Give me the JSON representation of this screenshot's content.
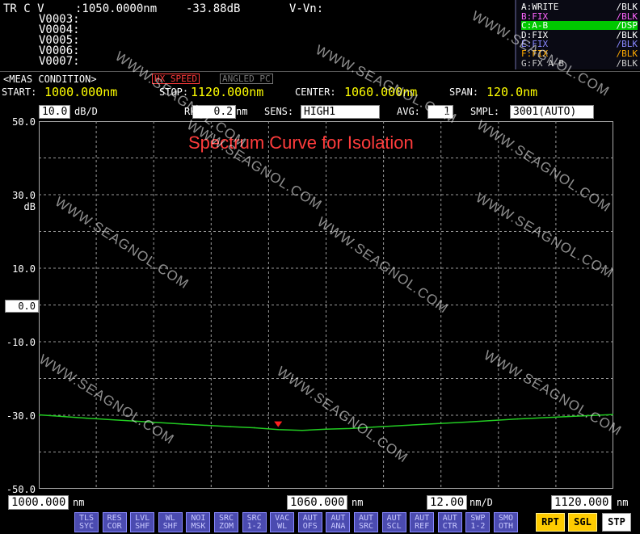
{
  "trace_info": {
    "header": "TR C V",
    "wavelength": ":1050.0000nm",
    "level": "-33.88dB",
    "delta": "V-Vn:",
    "rows": [
      "V0003:",
      "V0004:",
      "V0005:",
      "V0006:",
      "V0007:"
    ]
  },
  "trace_panel": [
    {
      "label": "A:WRITE",
      "mode": "/BLK",
      "color": "#ffffff"
    },
    {
      "label": "B:FIX",
      "mode": "/BLK",
      "color": "#ff66ff"
    },
    {
      "label": "C:A-B",
      "mode": "/DSP",
      "color": "#ffffff",
      "highlight": "#00c800"
    },
    {
      "label": "D:FIX",
      "mode": "/BLK",
      "color": "#ffffff"
    },
    {
      "label": "E:FIX",
      "mode": "/BLK",
      "color": "#8888ff"
    },
    {
      "label": "F:FIX",
      "mode": "/BLK",
      "color": "#ffaa00"
    },
    {
      "label": "G:FX A-B",
      "mode": "/BLK",
      "color": "#cccccc"
    }
  ],
  "meas_condition": {
    "title": "<MEAS CONDITION>",
    "hx_speed": "HX SPEED",
    "angled_pc": "ANGLED PC",
    "start_label": "START:",
    "start_value": "1000.000nm",
    "stop_label": "STOP:",
    "stop_value": "1120.000nm",
    "center_label": "CENTER:",
    "center_value": "1060.000nm",
    "span_label": "SPAN:",
    "span_value": "120.0nm"
  },
  "settings_bar": {
    "scale_value": "10.0",
    "scale_unit": "dB/D",
    "res_label": "RES:",
    "res_value": "0.2",
    "res_unit": "nm",
    "sens_label": "SENS:",
    "sens_value": "HIGH1",
    "avg_label": "AVG:",
    "avg_value": "1",
    "smpl_label": "SMPL:",
    "smpl_value": "3001(AUTO)"
  },
  "plot": {
    "title": "Spectrum Curve for Isolation",
    "y_unit": "dB",
    "ref_value": "0.0",
    "y_ticks": [
      "50.0",
      "30.0",
      "10.0",
      "-10.0",
      "-30.0",
      "-50.0"
    ]
  },
  "chart_data": {
    "type": "line",
    "title": "Spectrum Curve for Isolation",
    "xlabel": "nm",
    "ylabel": "dB",
    "xlim": [
      1000,
      1120
    ],
    "ylim": [
      -50,
      50
    ],
    "grid": true,
    "series": [
      {
        "color": "#22cc22",
        "x": [
          1000,
          1010,
          1020,
          1030,
          1040,
          1045,
          1050,
          1055,
          1060,
          1065,
          1070,
          1080,
          1090,
          1100,
          1110,
          1120
        ],
        "y": [
          -29.9,
          -30.8,
          -31.6,
          -32.4,
          -33.1,
          -33.4,
          -33.9,
          -34.1,
          -33.8,
          -33.6,
          -33.2,
          -32.5,
          -31.8,
          -31.0,
          -30.4,
          -29.8
        ]
      }
    ],
    "marker": {
      "x": 1050,
      "y": -33.88
    }
  },
  "x_axis": {
    "start": "1000.000",
    "start_unit": "nm",
    "center": "1060.000",
    "center_unit": "nm",
    "div": "12.00",
    "div_unit": "nm/D",
    "stop": "1120.000",
    "stop_unit": "nm"
  },
  "function_buttons": [
    {
      "top": "TLS",
      "bottom": "SYC"
    },
    {
      "top": "RES",
      "bottom": "COR"
    },
    {
      "top": "LVL",
      "bottom": "SHF"
    },
    {
      "top": "WL",
      "bottom": "SHF"
    },
    {
      "top": "NOI",
      "bottom": "MSK"
    },
    {
      "top": "SRC",
      "bottom": "ZOM"
    },
    {
      "top": "SRC",
      "bottom": "1-2"
    },
    {
      "top": "VAC",
      "bottom": "WL"
    },
    {
      "top": "AUT",
      "bottom": "OFS"
    },
    {
      "top": "AUT",
      "bottom": "ANA"
    },
    {
      "top": "AUT",
      "bottom": "SRC"
    },
    {
      "top": "AUT",
      "bottom": "SCL"
    },
    {
      "top": "AUT",
      "bottom": "REF"
    },
    {
      "top": "AUT",
      "bottom": "CTR"
    },
    {
      "top": "SWP",
      "bottom": "1-2"
    },
    {
      "top": "SMO",
      "bottom": "OTH"
    }
  ],
  "sweep_buttons": [
    "RPT",
    "SGL",
    "STP"
  ],
  "watermark_text": "WWW.SEAGNOL.COM"
}
